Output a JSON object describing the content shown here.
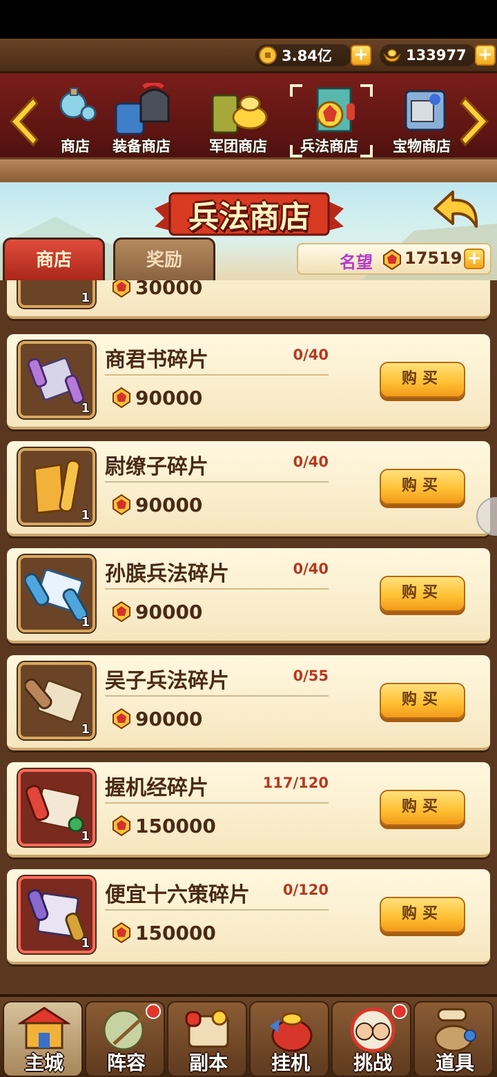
{
  "currency": {
    "coins": "3.84亿",
    "ingots": "133977"
  },
  "shop_tabs": [
    {
      "label": "商店",
      "icon": "potion-shop-icon"
    },
    {
      "label": "装备商店",
      "icon": "armor-helmet-icon"
    },
    {
      "label": "军团商店",
      "icon": "gold-ingot-icon"
    },
    {
      "label": "兵法商店",
      "icon": "war-book-icon",
      "active": true
    },
    {
      "label": "宝物商店",
      "icon": "treasure-icon"
    }
  ],
  "banner": {
    "title": "兵法商店",
    "subtabs": [
      "商店",
      "奖励"
    ],
    "fame_label": "名望",
    "fame_value": "17519"
  },
  "items": [
    {
      "name": "",
      "progress": "",
      "price": "30000",
      "count": "1",
      "frame": "brown"
    },
    {
      "name": "商君书碎片",
      "progress": "0/40",
      "price": "90000",
      "count": "1",
      "frame": "brown",
      "buy_label": "购买"
    },
    {
      "name": "尉缭子碎片",
      "progress": "0/40",
      "price": "90000",
      "count": "1",
      "frame": "brown",
      "buy_label": "购买"
    },
    {
      "name": "孙膑兵法碎片",
      "progress": "0/40",
      "price": "90000",
      "count": "1",
      "frame": "brown",
      "buy_label": "购买"
    },
    {
      "name": "吴子兵法碎片",
      "progress": "0/55",
      "price": "90000",
      "count": "1",
      "frame": "brown",
      "buy_label": "购买"
    },
    {
      "name": "握机经碎片",
      "progress": "117/120",
      "price": "150000",
      "count": "1",
      "frame": "red",
      "buy_label": "购买"
    },
    {
      "name": "便宜十六策碎片",
      "progress": "0/120",
      "price": "150000",
      "count": "1",
      "frame": "red",
      "buy_label": "购买"
    }
  ],
  "nav": [
    {
      "label": "主城",
      "active": true
    },
    {
      "label": "阵容",
      "badge": true
    },
    {
      "label": "副本"
    },
    {
      "label": "挂机"
    },
    {
      "label": "挑战",
      "badge": true
    },
    {
      "label": "道具"
    }
  ],
  "colors": {
    "accent_gold": "#ffc236",
    "progress_red": "#b43a22",
    "fame_purple": "#b33ad0"
  }
}
